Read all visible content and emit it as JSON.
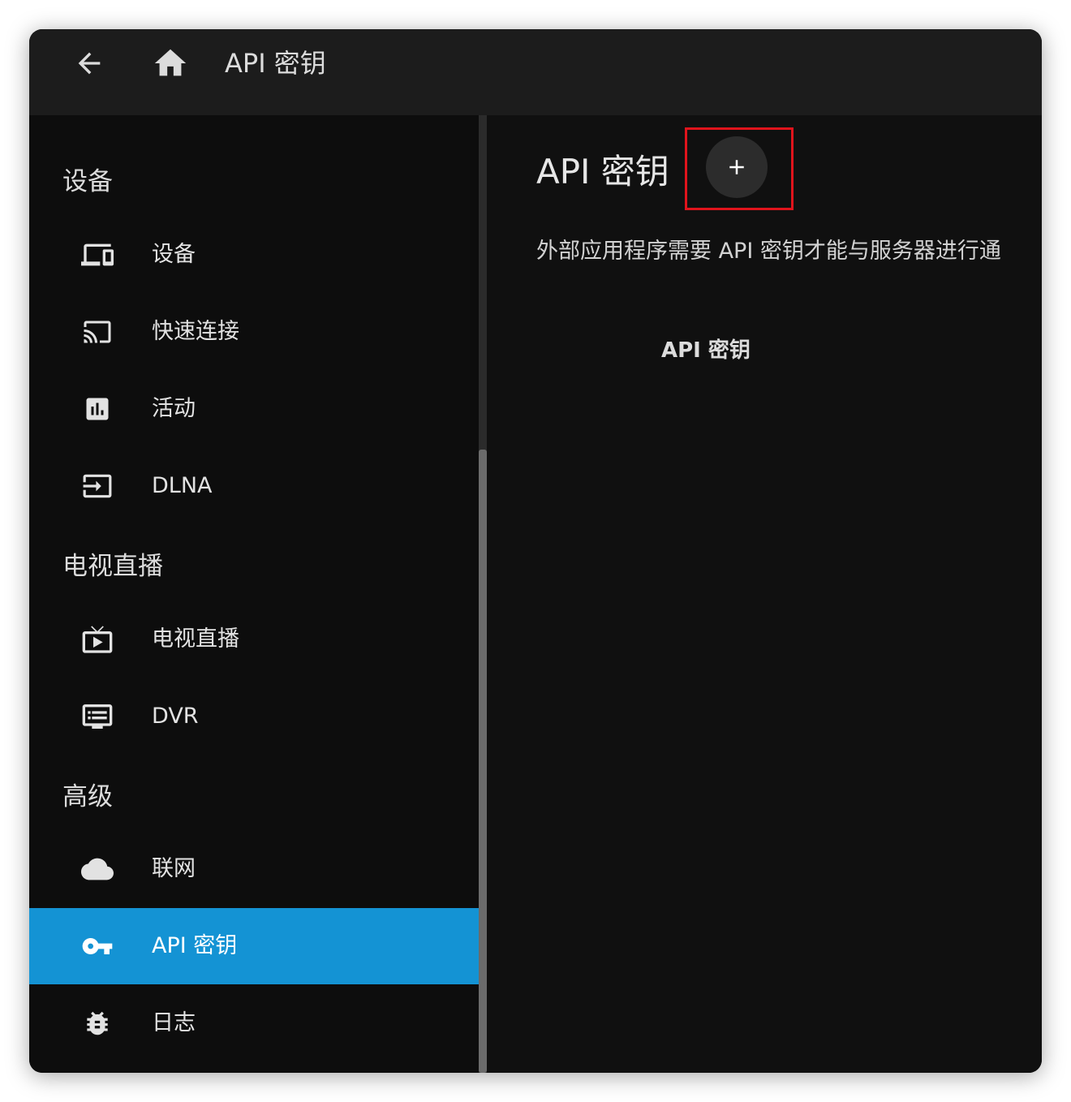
{
  "header": {
    "title": "API 密钥",
    "back_icon": "arrow-left-icon",
    "home_icon": "home-icon"
  },
  "sidebar": {
    "sections": [
      {
        "title": "设备",
        "items": [
          {
            "label": "设备",
            "icon": "devices-icon"
          },
          {
            "label": "快速连接",
            "icon": "cast-icon"
          },
          {
            "label": "活动",
            "icon": "bar-chart-icon"
          },
          {
            "label": "DLNA",
            "icon": "input-icon"
          }
        ]
      },
      {
        "title": "电视直播",
        "items": [
          {
            "label": "电视直播",
            "icon": "live-tv-icon"
          },
          {
            "label": "DVR",
            "icon": "dvr-icon"
          }
        ]
      },
      {
        "title": "高级",
        "items": [
          {
            "label": "联网",
            "icon": "cloud-icon"
          },
          {
            "label": "API 密钥",
            "icon": "key-icon",
            "active": true
          },
          {
            "label": "日志",
            "icon": "bug-icon"
          }
        ]
      }
    ]
  },
  "main": {
    "title": "API 密钥",
    "add_button_label": "+",
    "description": "外部应用程序需要 API 密钥才能与服务器进行通",
    "table": {
      "columns": [
        "API 密钥"
      ],
      "rows": []
    }
  },
  "colors": {
    "header_bg": "#1c1c1c",
    "sidebar_bg": "#0d0d0d",
    "active_item": "#1493d4",
    "highlight": "#e0141c"
  }
}
